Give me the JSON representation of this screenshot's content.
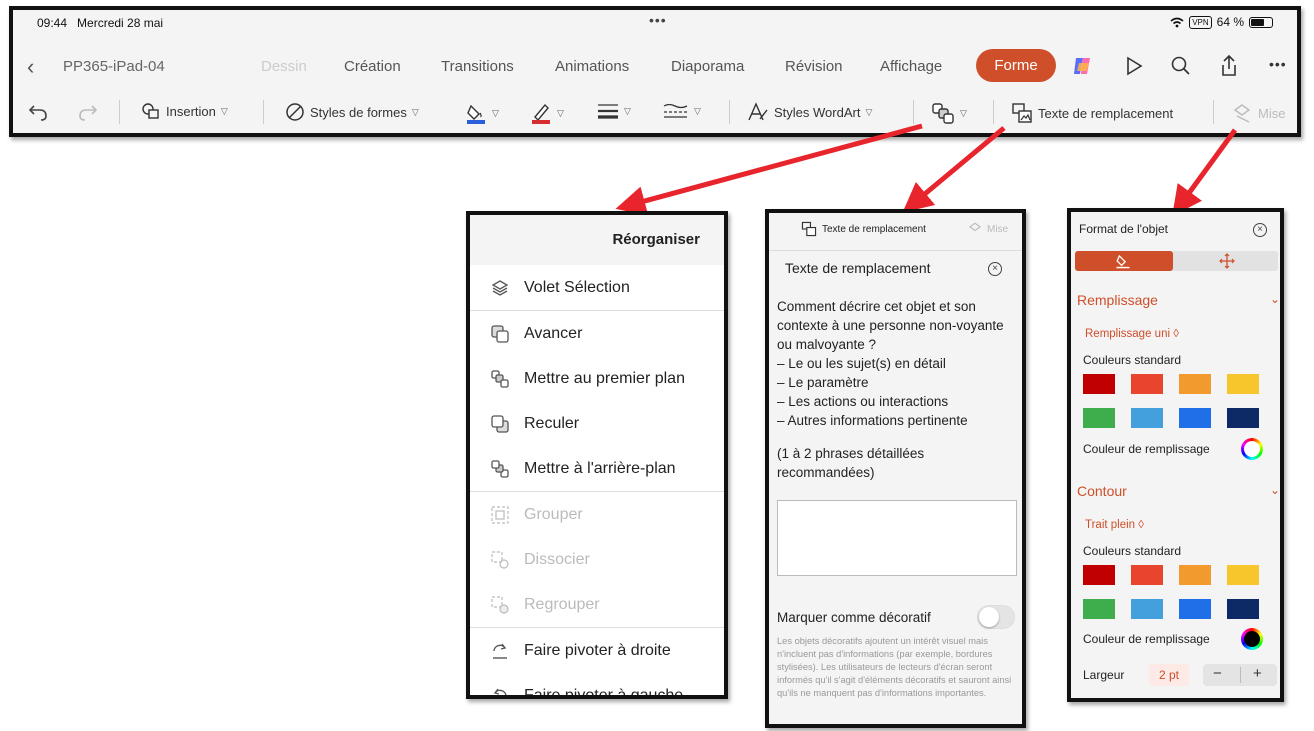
{
  "status_bar": {
    "time": "09:44",
    "date": "Mercredi 28 mai",
    "vpn": "VPN",
    "battery": "64 %"
  },
  "document": {
    "title": "PP365-iPad-04"
  },
  "tabs": [
    "Dessin",
    "Création",
    "Transitions",
    "Animations",
    "Diaporama",
    "Révision",
    "Affichage"
  ],
  "active_tab": "Forme",
  "toolbar": {
    "insertion": "Insertion",
    "shape_styles": "Styles de formes",
    "wordart": "Styles WordArt",
    "alt_text": "Texte de remplacement",
    "more": "Mise"
  },
  "reorganize": {
    "title": "Réorganiser",
    "items": [
      {
        "label": "Volet Sélection",
        "enabled": true
      },
      {
        "label": "Avancer",
        "enabled": true
      },
      {
        "label": "Mettre au premier plan",
        "enabled": true
      },
      {
        "label": "Reculer",
        "enabled": true
      },
      {
        "label": "Mettre à l'arrière-plan",
        "enabled": true
      },
      {
        "label": "Grouper",
        "enabled": false
      },
      {
        "label": "Dissocier",
        "enabled": false
      },
      {
        "label": "Regrouper",
        "enabled": false
      },
      {
        "label": "Faire pivoter à droite",
        "enabled": true
      },
      {
        "label": "Faire pivoter à gauche",
        "enabled": true
      }
    ]
  },
  "alt_panel": {
    "tab_label": "Texte de remplacement",
    "tab2_label": "Mise",
    "title": "Texte de remplacement",
    "question": "Comment décrire cet objet et son contexte à une personne non-voyante ou malvoyante ?",
    "bullets": [
      "– Le ou les sujet(s) en détail",
      "– Le paramètre",
      "– Les actions ou interactions",
      "– Autres informations pertinente"
    ],
    "recommendation": "(1 à 2 phrases détaillées recommandées)",
    "decorative_label": "Marquer comme décoratif",
    "decorative_note": "Les objets décoratifs ajoutent un intérêt visuel mais n'incluent pas d'informations (par exemple, bordures stylisées). Les utilisateurs de lecteurs d'écran seront informés qu'il s'agit d'éléments décoratifs et sauront ainsi qu'ils ne manquent pas d'informations importantes."
  },
  "format_panel": {
    "title": "Format de l'objet",
    "fill_section": "Remplissage",
    "fill_type": "Remplissage uni ◊",
    "std_colors": "Couleurs standard",
    "fill_color_label": "Couleur de remplissage",
    "outline_section": "Contour",
    "outline_type": "Trait plein ◊",
    "std_colors2": "Couleurs standard",
    "outline_color_label": "Couleur de remplissage",
    "width_label": "Largeur",
    "width_value": "2 pt",
    "minus": "−",
    "plus": "+",
    "swatches": [
      "#c00000",
      "#e8442e",
      "#f29a2e",
      "#f7c52c",
      "#3eae4c",
      "#43a0dc",
      "#1e6fe8",
      "#0d2a66"
    ]
  }
}
